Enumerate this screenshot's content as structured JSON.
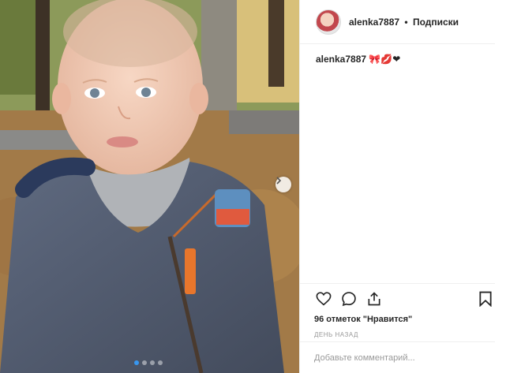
{
  "post": {
    "username": "alenka7887",
    "separator": "•",
    "follow_label": "Подписки",
    "caption_user": "alenka7887",
    "caption_text": " 🎀💋❤",
    "likes_text": "96 отметок \"Нравится\"",
    "date_text": "ДЕНЬ НАЗАД",
    "comment_placeholder": "Добавьте комментарий..."
  },
  "carousel": {
    "total_slides": 4,
    "active_slide": 1
  },
  "icons": {
    "like": "heart-icon",
    "comment": "comment-bubble-icon",
    "share": "share-icon",
    "save": "bookmark-icon",
    "next": "chevron-right-icon"
  },
  "colors": {
    "accent": "#3897f0",
    "text": "#262626",
    "muted": "#999999",
    "divider": "#efefef"
  }
}
